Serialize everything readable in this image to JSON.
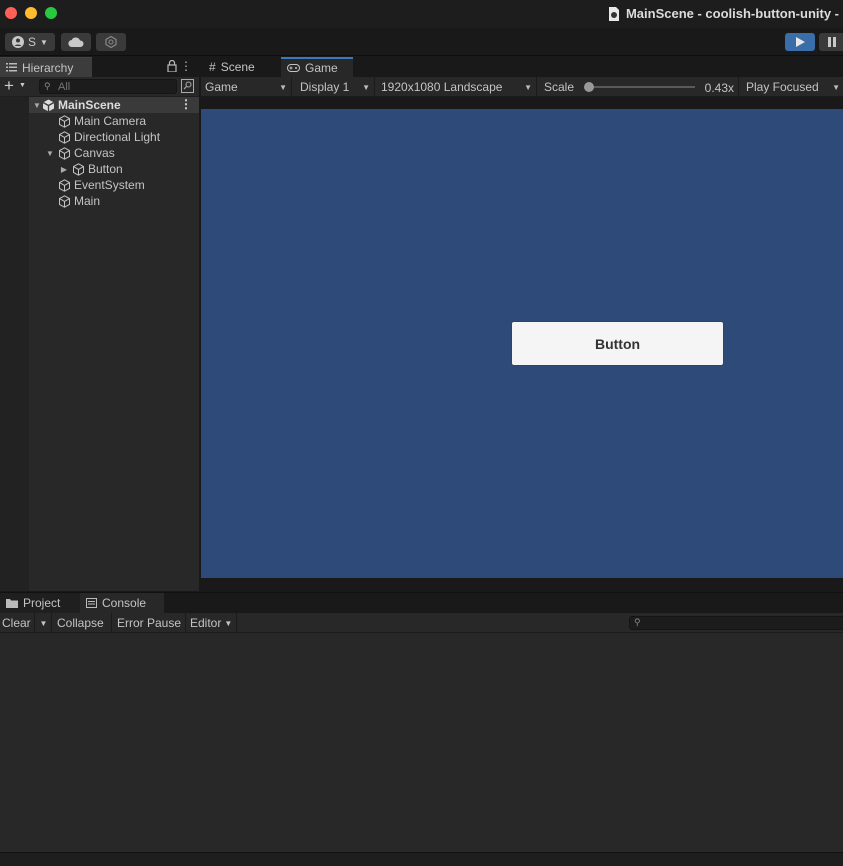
{
  "window": {
    "title": "MainScene - coolish-button-unity -"
  },
  "toolbar": {
    "account_label": "S"
  },
  "hierarchy": {
    "tab_label": "Hierarchy",
    "search_placeholder": "All",
    "scene": "MainScene",
    "items": [
      {
        "label": "Main Camera"
      },
      {
        "label": "Directional Light"
      },
      {
        "label": "Canvas"
      },
      {
        "label": "Button"
      },
      {
        "label": "EventSystem"
      },
      {
        "label": "Main"
      }
    ]
  },
  "view": {
    "tabs": [
      {
        "label": "Scene"
      },
      {
        "label": "Game"
      }
    ],
    "game_dropdown": "Game",
    "display_dropdown": "Display 1",
    "resolution_dropdown": "1920x1080 Landscape",
    "scale_label": "Scale",
    "scale_value": "0.43x",
    "play_mode_dropdown": "Play Focused",
    "game_button_label": "Button",
    "background_color": "#2e4a78"
  },
  "bottom": {
    "tabs": [
      {
        "label": "Project"
      },
      {
        "label": "Console"
      }
    ],
    "clear_label": "Clear",
    "collapse_label": "Collapse",
    "error_pause_label": "Error Pause",
    "editor_label": "Editor",
    "search_placeholder": ""
  },
  "colors": {
    "accent": "#3a6ea8",
    "play_button": "#3a6ea8",
    "game_bg": "#2e4a78"
  }
}
